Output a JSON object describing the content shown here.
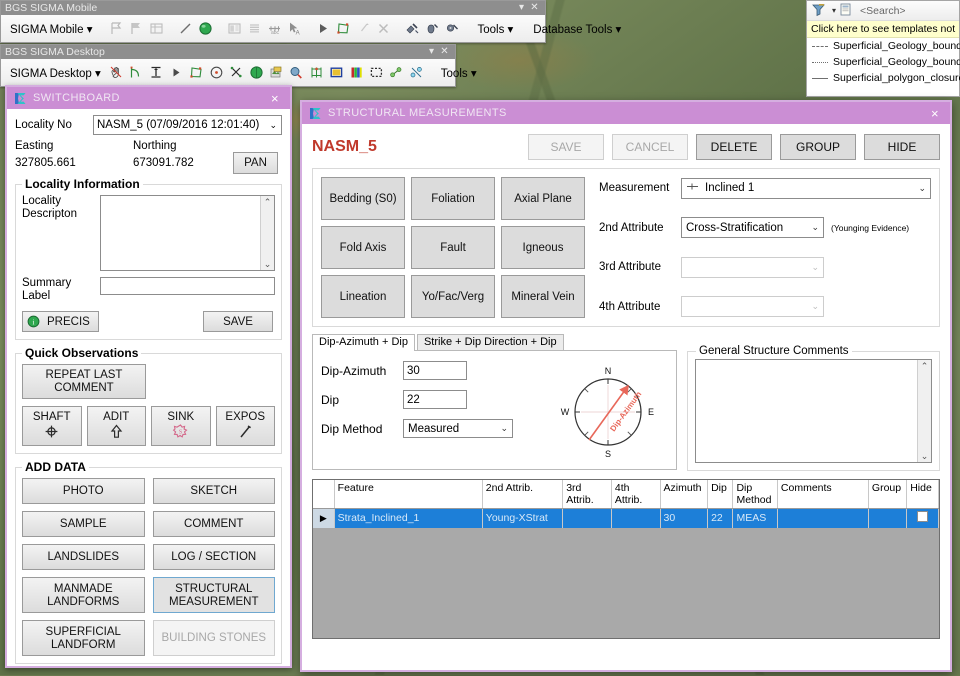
{
  "mobile_toolbar": {
    "title": "BGS SIGMA Mobile",
    "menu": "SIGMA Mobile",
    "tools": "Tools",
    "database_tools": "Database Tools",
    "icons": [
      "flag-outline-icon",
      "flag-filled-icon",
      "table-icon",
      "line-draw-icon",
      "green-sphere-icon",
      "form-icon",
      "list-icon",
      "measure-icon",
      "select-arrow-icon",
      "play-arrow-icon",
      "polygon-icon",
      "wand-icon",
      "delete-x-icon",
      "satellite-icon",
      "hand-gps-icon",
      "gps-locate-icon"
    ]
  },
  "desktop_toolbar": {
    "title": "BGS SIGMA Desktop",
    "menu": "SIGMA Desktop",
    "tools": "Tools",
    "icons": [
      "hand-pan-icon",
      "curve-icon",
      "extend-icon",
      "play-arrow-icon",
      "polygon-icon",
      "rotate-icon",
      "sparkle-icon",
      "green-sphere-icon",
      "map-layers-icon",
      "magnify-globe-icon",
      "grid-icon",
      "square-outline-icon",
      "color-bars-icon",
      "dashed-box-icon",
      "nodes-icon",
      "snap-icon"
    ]
  },
  "templates_panel": {
    "filter_icon": "filter-icon",
    "create-template-icon": "create-template-icon",
    "search_placeholder": "<Search>",
    "note": "Click here to see templates not",
    "items": [
      {
        "label": "Superficial_Geology_boundary",
        "style": "dashed"
      },
      {
        "label": "Superficial_Geology_boundary",
        "style": "dotted"
      },
      {
        "label": "Superficial_polygon_closure",
        "style": "solid"
      }
    ]
  },
  "switchboard": {
    "title": "SWITCHBOARD",
    "close": "×",
    "locality_no_label": "Locality No",
    "locality_no_value": "NASM_5   (07/09/2016 12:01:40)",
    "easting_label": "Easting",
    "northing_label": "Northing",
    "easting_value": "327805.661",
    "northing_value": "673091.782",
    "pan_button": "PAN",
    "locality_info_legend": "Locality Information",
    "locality_description_label_1": "Locality",
    "locality_description_label_2": "Descripton",
    "locality_description_value": "",
    "summary_label_1": "Summary",
    "summary_label_2": "Label",
    "summary_value": "",
    "precis_button": "PRECIS",
    "save_button": "SAVE",
    "quick_observations_legend": "Quick Observations",
    "repeat_last_comment_button": "REPEAT LAST COMMENT",
    "quick_buttons": [
      {
        "label": "SHAFT",
        "icon": "shaft-crosshair-icon"
      },
      {
        "label": "ADIT",
        "icon": "adit-arrow-icon"
      },
      {
        "label": "SINK",
        "icon": "sinkhole-icon"
      },
      {
        "label": "EXPOS",
        "icon": "exposure-hammer-icon"
      }
    ],
    "add_data_legend": "ADD DATA",
    "add_data_buttons": [
      {
        "label": "PHOTO",
        "state": "normal"
      },
      {
        "label": "SKETCH",
        "state": "normal"
      },
      {
        "label": "SAMPLE",
        "state": "normal"
      },
      {
        "label": "COMMENT",
        "state": "normal"
      },
      {
        "label": "LANDSLIDES",
        "state": "normal"
      },
      {
        "label": "LOG / SECTION",
        "state": "normal"
      },
      {
        "label": "MANMADE LANDFORMS",
        "state": "normal"
      },
      {
        "label": "STRUCTURAL MEASUREMENT",
        "state": "selected"
      },
      {
        "label": "SUPERFICIAL LANDFORM",
        "state": "normal"
      },
      {
        "label": "BUILDING STONES",
        "state": "disabled"
      }
    ]
  },
  "structural": {
    "title": "STRUCTURAL MEASUREMENTS",
    "close": "×",
    "locality": "NASM_5",
    "actions": [
      {
        "label": "SAVE",
        "state": "disabled"
      },
      {
        "label": "CANCEL",
        "state": "disabled"
      },
      {
        "label": "DELETE",
        "state": "normal"
      },
      {
        "label": "GROUP",
        "state": "normal"
      },
      {
        "label": "HIDE",
        "state": "normal"
      }
    ],
    "types": [
      "Bedding (S0)",
      "Foliation",
      "Axial Plane",
      "Fold Axis",
      "Fault",
      "Igneous",
      "Lineation",
      "Yo/Fac/Verg",
      "Mineral Vein"
    ],
    "measurement_label": "Measurement",
    "measurement_value": "Inclined 1",
    "attr2_label": "2nd Attribute",
    "attr2_value": "Cross-Stratification",
    "attr2_hint": "(Younging Evidence)",
    "attr3_label": "3rd Attribute",
    "attr3_value": "",
    "attr4_label": "4th Attribute",
    "attr4_value": "",
    "tabs": [
      {
        "label": "Dip-Azimuth + Dip",
        "active": true
      },
      {
        "label": "Strike + Dip Direction + Dip",
        "active": false
      }
    ],
    "dip_azimuth_label": "Dip-Azimuth",
    "dip_azimuth_value": "30",
    "dip_label": "Dip",
    "dip_value": "22",
    "dip_method_label": "Dip Method",
    "dip_method_value": "Measured",
    "compass": {
      "n": "N",
      "e": "E",
      "s": "S",
      "w": "W",
      "arrow_label": "Dip-Azimuth",
      "arrow_color": "#e8685a"
    },
    "comments_legend": "General Structure Comments",
    "comments_value": "",
    "table": {
      "columns": [
        "Feature",
        "2nd Attrib.",
        "3rd Attrib.",
        "4th Attrib.",
        "Azimuth",
        "Dip",
        "Dip Method",
        "Comments",
        "Group",
        "Hide"
      ],
      "rows": [
        {
          "marker": "▶",
          "feature": "Strata_Inclined_1",
          "attrib2": "Young-XStrat",
          "attrib3": "",
          "attrib4": "",
          "azimuth": "30",
          "dip": "22",
          "dip_method": "MEAS",
          "comments": "",
          "group": "",
          "hide_checked": false
        }
      ]
    }
  },
  "colors": {
    "title_purple": "#cb8ed4",
    "window_border": "#d5aee0",
    "selection_blue": "#1d7fd8",
    "locality_red": "#c0392b",
    "note_yellow": "#ffffcc"
  }
}
